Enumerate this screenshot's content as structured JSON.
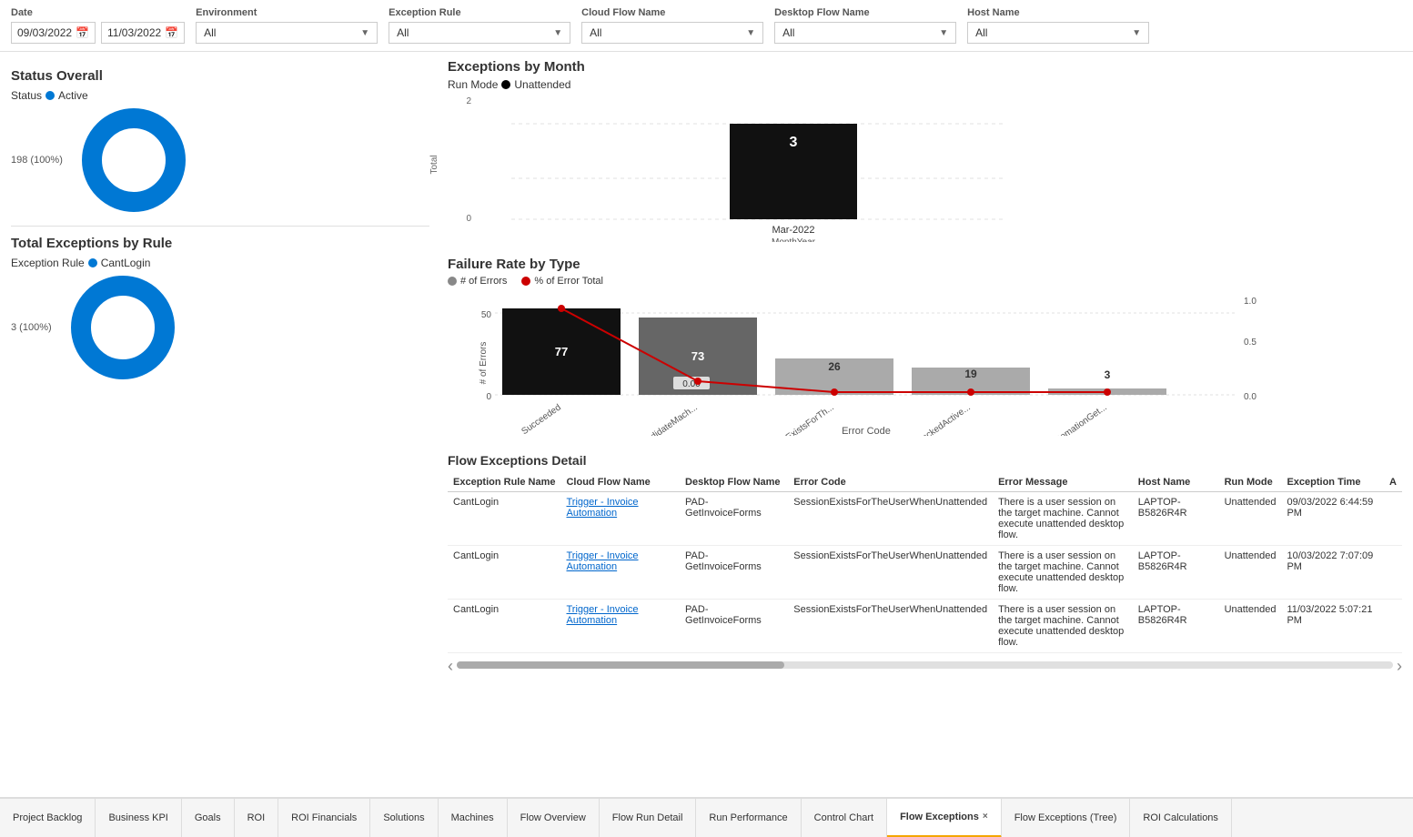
{
  "filters": {
    "date_label": "Date",
    "date_start": "09/03/2022",
    "date_end": "11/03/2022",
    "environment_label": "Environment",
    "environment_value": "All",
    "exception_rule_label": "Exception Rule",
    "exception_rule_value": "All",
    "cloud_flow_label": "Cloud Flow Name",
    "cloud_flow_value": "All",
    "desktop_flow_label": "Desktop Flow Name",
    "desktop_flow_value": "All",
    "host_name_label": "Host Name",
    "host_name_value": "All"
  },
  "status_overall": {
    "title": "Status Overall",
    "status_label": "Status",
    "status_value": "Active",
    "donut_label": "198 (100%)"
  },
  "total_exceptions": {
    "title": "Total Exceptions by Rule",
    "exception_label": "Exception Rule",
    "exception_value": "CantLogin",
    "donut_label": "3 (100%)"
  },
  "exceptions_by_month": {
    "title": "Exceptions by Month",
    "run_mode_label": "Run Mode",
    "run_mode_value": "Unattended",
    "bar_value": "3",
    "bar_month": "Mar-2022",
    "axis_label": "MonthYear",
    "y_axis_label": "Total",
    "y_max": "2",
    "y_min": "0"
  },
  "failure_rate": {
    "title": "Failure Rate by Type",
    "legend_errors": "# of Errors",
    "legend_percent": "% of Error Total",
    "y_label": "# of Errors",
    "x_label": "Error Code",
    "bars": [
      {
        "label": "Succeeded",
        "value": 77,
        "percent": null
      },
      {
        "label": "NoCandidateMach...",
        "value": 73,
        "percent": "0.00"
      },
      {
        "label": "SessionExistsForTh...",
        "value": 26,
        "percent": null
      },
      {
        "label": "NoUnlockedActive...",
        "value": 19,
        "percent": null
      },
      {
        "label": "UIAutomationGet...",
        "value": 3,
        "percent": null
      }
    ],
    "y_ticks": [
      "50",
      "0"
    ],
    "y_right_ticks": [
      "1.0",
      "0.5",
      "0.0"
    ]
  },
  "detail_section": {
    "title": "Flow Exceptions Detail",
    "columns": [
      "Exception Rule Name",
      "Cloud Flow Name",
      "Desktop Flow Name",
      "Error Code",
      "Error Message",
      "Host Name",
      "Run Mode",
      "Exception Time",
      "A"
    ],
    "rows": [
      {
        "exception_rule": "CantLogin",
        "cloud_flow": "Trigger - Invoice Automation",
        "desktop_flow": "PAD-GetInvoiceForms",
        "error_code": "SessionExistsForTheUserWhenUnattended",
        "error_message": "There is a user session on the target machine. Cannot execute unattended desktop flow.",
        "host_name": "LAPTOP-B5826R4R",
        "run_mode": "Unattended",
        "exception_time": "09/03/2022 6:44:59 PM"
      },
      {
        "exception_rule": "CantLogin",
        "cloud_flow": "Trigger - Invoice Automation",
        "desktop_flow": "PAD-GetInvoiceForms",
        "error_code": "SessionExistsForTheUserWhenUnattended",
        "error_message": "There is a user session on the target machine. Cannot execute unattended desktop flow.",
        "host_name": "LAPTOP-B5826R4R",
        "run_mode": "Unattended",
        "exception_time": "10/03/2022 7:07:09 PM"
      },
      {
        "exception_rule": "CantLogin",
        "cloud_flow": "Trigger - Invoice Automation",
        "desktop_flow": "PAD-GetInvoiceForms",
        "error_code": "SessionExistsForTheUserWhenUnattended",
        "error_message": "There is a user session on the target machine. Cannot execute unattended desktop flow.",
        "host_name": "LAPTOP-B5826R4R",
        "run_mode": "Unattended",
        "exception_time": "11/03/2022 5:07:21 PM"
      }
    ]
  },
  "tabs": [
    {
      "label": "Project Backlog",
      "active": false,
      "closeable": false
    },
    {
      "label": "Business KPI",
      "active": false,
      "closeable": false
    },
    {
      "label": "Goals",
      "active": false,
      "closeable": false
    },
    {
      "label": "ROI",
      "active": false,
      "closeable": false
    },
    {
      "label": "ROI Financials",
      "active": false,
      "closeable": false
    },
    {
      "label": "Solutions",
      "active": false,
      "closeable": false
    },
    {
      "label": "Machines",
      "active": false,
      "closeable": false
    },
    {
      "label": "Flow Overview",
      "active": false,
      "closeable": false
    },
    {
      "label": "Flow Run Detail",
      "active": false,
      "closeable": false
    },
    {
      "label": "Run Performance",
      "active": false,
      "closeable": false
    },
    {
      "label": "Control Chart",
      "active": false,
      "closeable": false
    },
    {
      "label": "Flow Exceptions",
      "active": true,
      "closeable": true
    },
    {
      "label": "Flow Exceptions (Tree)",
      "active": false,
      "closeable": false
    },
    {
      "label": "ROI Calculations",
      "active": false,
      "closeable": false
    }
  ]
}
